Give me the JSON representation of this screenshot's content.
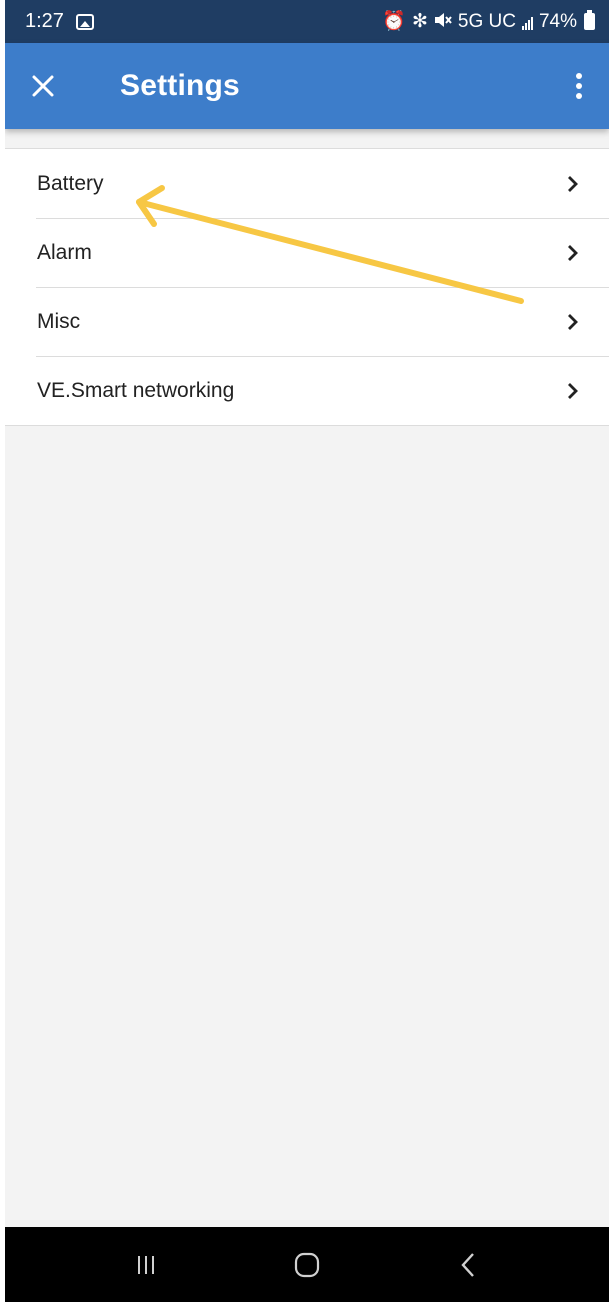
{
  "status_bar": {
    "time": "1:27",
    "network": "5G UC",
    "battery": "74%",
    "icons": [
      "gallery-icon",
      "alarm-icon",
      "bluetooth-icon",
      "mute-icon",
      "signal-icon",
      "battery-icon"
    ]
  },
  "app_bar": {
    "title": "Settings",
    "close_icon": "close-icon",
    "menu_icon": "more-vert-icon",
    "color": "#3d7dca"
  },
  "menu": {
    "items": [
      {
        "label": "Battery",
        "icon": "chevron-right-icon"
      },
      {
        "label": "Alarm",
        "icon": "chevron-right-icon"
      },
      {
        "label": "Misc",
        "icon": "chevron-right-icon"
      },
      {
        "label": "VE.Smart networking",
        "icon": "chevron-right-icon"
      }
    ]
  },
  "annotation": {
    "type": "arrow",
    "points_to": "Battery",
    "color": "#f7c744"
  },
  "nav_bar": {
    "buttons": [
      "recent-apps-icon",
      "home-icon",
      "back-icon"
    ]
  },
  "colors": {
    "status_bar": "#1f3d63",
    "app_bar": "#3d7dca",
    "background": "#f3f3f3",
    "annotation": "#f7c744"
  }
}
